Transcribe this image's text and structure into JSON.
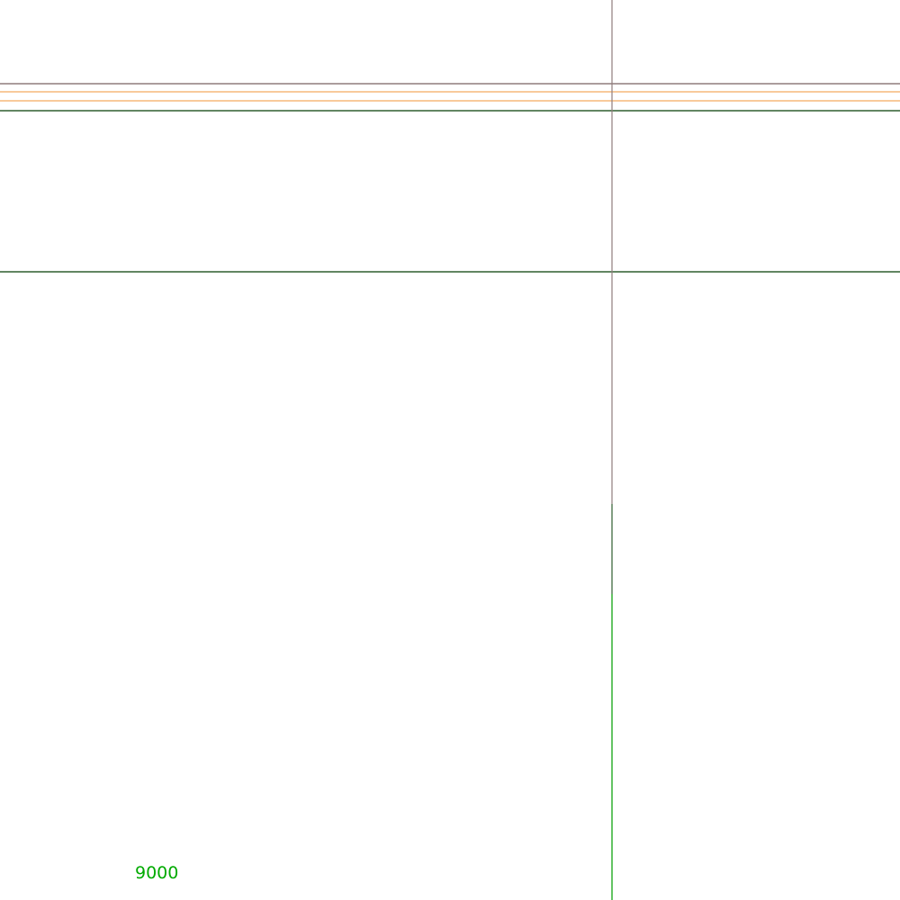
{
  "map": {
    "labels": {
      "contour_label": "9000"
    },
    "features": [
      {
        "name": "road-horizontal-gray",
        "color": "#8f7d7d"
      },
      {
        "name": "road-horizontal-orange-1",
        "color": "#f5b97a"
      },
      {
        "name": "road-horizontal-orange-2",
        "color": "#f5b97a"
      },
      {
        "name": "road-horizontal-dark-green-1",
        "color": "#2f5e2f"
      },
      {
        "name": "road-horizontal-dark-green-2",
        "color": "#2f5e2f"
      },
      {
        "name": "road-vertical-gray",
        "color": "#8f7d7d"
      },
      {
        "name": "road-vertical-green",
        "color": "#22aa22"
      }
    ],
    "colors": {
      "background": "#ffffff",
      "label": "#00aa00"
    }
  }
}
